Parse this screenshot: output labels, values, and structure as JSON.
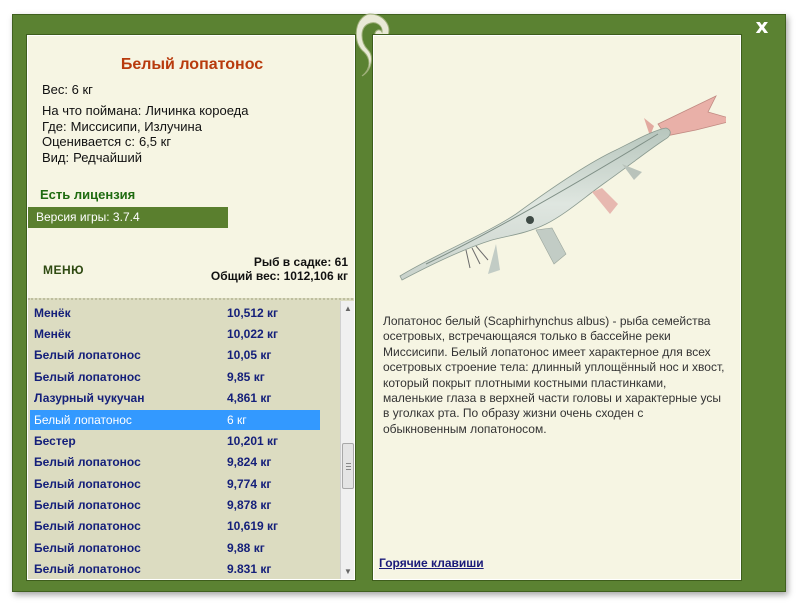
{
  "window": {
    "close_label": "x",
    "colors": {
      "frame": "#5b8232",
      "panel": "#f6f5e3",
      "list_bg": "#dcdcc1",
      "selected": "#3399ff",
      "title": "#b83a0c"
    }
  },
  "fish": {
    "name": "Белый лопатонос",
    "weight": "Вес: 6 кг",
    "details": [
      {
        "label": "На что поймана:",
        "value": "Личинка короеда"
      },
      {
        "label": "Где:",
        "value": "Миссисипи, Излучина"
      },
      {
        "label": "Оценивается с:",
        "value": "6,5 кг"
      },
      {
        "label": "Вид:",
        "value": "Редчайший"
      }
    ],
    "description": "Лопатонос белый (Scaphirhynchus albus) - рыба семейства осетровых, встречающаяся только в бассейне реки Миссисипи. Белый лопатонос имеет характерное для всех осетровых строение тела: длинный уплощённый нос и хвост, который покрыт плотными костными пластинками, маленькие глаза в верхней части головы и характерные усы в уголках рта. По образу жизни очень сходен с обыкновенным лопатоносом."
  },
  "license": "Есть лицензия",
  "version": "Версия игры: 3.7.4",
  "menu_label": "МЕНЮ",
  "stats": {
    "count": "Рыб в садке: 61",
    "total": "Общий вес: 1012,106 кг"
  },
  "catches": [
    {
      "name": "Менёк",
      "weight": "10,512 кг",
      "selected": false
    },
    {
      "name": "Менёк",
      "weight": "10,022 кг",
      "selected": false
    },
    {
      "name": "Белый лопатонос",
      "weight": "10,05 кг",
      "selected": false
    },
    {
      "name": "Белый лопатонос",
      "weight": "9,85 кг",
      "selected": false
    },
    {
      "name": "Лазурный чукучан",
      "weight": "4,861 кг",
      "selected": false
    },
    {
      "name": "Белый лопатонос",
      "weight": "6 кг",
      "selected": true
    },
    {
      "name": "Бестер",
      "weight": "10,201 кг",
      "selected": false
    },
    {
      "name": "Белый лопатонос",
      "weight": "9,824 кг",
      "selected": false
    },
    {
      "name": "Белый лопатонос",
      "weight": "9,774 кг",
      "selected": false
    },
    {
      "name": "Белый лопатонос",
      "weight": "9,878 кг",
      "selected": false
    },
    {
      "name": "Белый лопатонос",
      "weight": "10,619 кг",
      "selected": false
    },
    {
      "name": "Белый лопатонос",
      "weight": "9,88 кг",
      "selected": false
    },
    {
      "name": "Белый лопатонос",
      "weight": "9.831 кг",
      "selected": false
    }
  ],
  "hotkeys_link": "Горячие клавиши"
}
